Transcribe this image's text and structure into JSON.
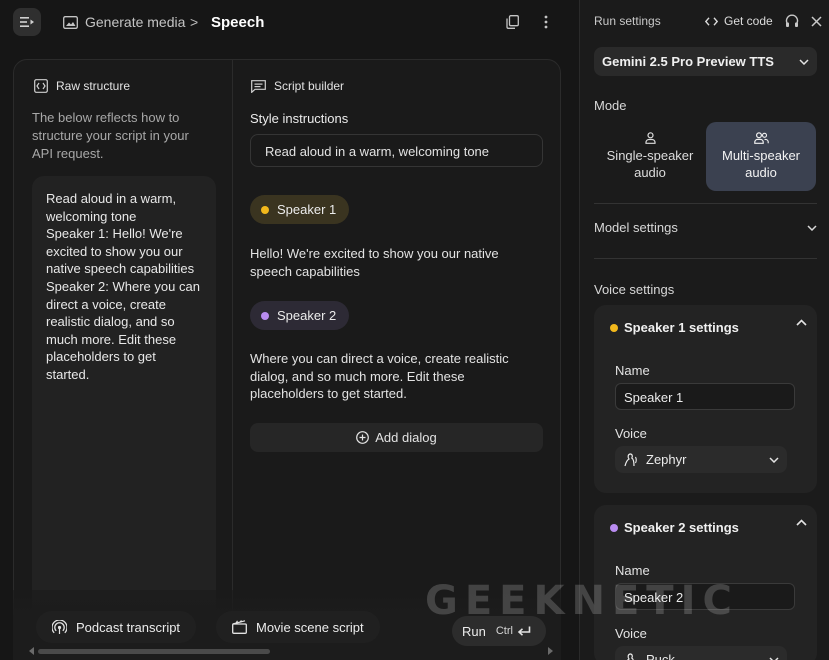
{
  "topbar": {
    "breadcrumb_parent": "Generate media",
    "breadcrumb_separator": ">",
    "breadcrumb_current": "Speech"
  },
  "raw_structure": {
    "heading": "Raw structure",
    "description": "The below reflects how to structure your script in your API request.",
    "content": "Read aloud in a warm, welcoming tone\nSpeaker 1: Hello! We're excited to show you our native speech capabilities\nSpeaker 2: Where you can direct a voice, create realistic dialog, and so much more. Edit these placeholders to get started."
  },
  "script_builder": {
    "heading": "Script builder",
    "style_label": "Style instructions",
    "style_value": "Read aloud in a warm, welcoming tone",
    "speaker1_name": "Speaker 1",
    "speaker1_text": "Hello! We're excited to show you our native speech capabilities",
    "speaker2_name": "Speaker 2",
    "speaker2_text": "Where you can direct a voice, create realistic dialog, and so much more. Edit these placeholders to get started.",
    "add_dialog": "Add dialog"
  },
  "bottom": {
    "podcast": "Podcast transcript",
    "movie": "Movie scene script",
    "run": "Run",
    "run_shortcut": "Ctrl"
  },
  "run_settings": {
    "title": "Run settings",
    "get_code": "Get code",
    "model": "Gemini 2.5 Pro Preview TTS",
    "mode_label": "Mode",
    "mode_single": "Single-speaker audio",
    "mode_multi": "Multi-speaker audio",
    "model_settings": "Model settings",
    "voice_settings": "Voice settings",
    "speaker1_settings": "Speaker 1 settings",
    "speaker2_settings": "Speaker 2 settings",
    "name_label": "Name",
    "voice_label": "Voice",
    "speaker1_name_value": "Speaker 1",
    "speaker1_voice": "Zephyr",
    "speaker2_name_value": "Speaker 2",
    "speaker2_voice": "Puck"
  },
  "watermark": "GEEKNETIC",
  "colors": {
    "speaker1_dot": "#f2b81c",
    "speaker2_dot": "#b98cf0",
    "mode_selected_bg": "#3b4150"
  },
  "icons": [
    "menu-collapse-icon",
    "image-icon",
    "copy-icon",
    "more-vert-icon",
    "raw-structure-icon",
    "script-builder-icon",
    "add-circle-icon",
    "podcast-icon",
    "movie-icon",
    "enter-icon",
    "code-icon",
    "compare-icon",
    "close-icon",
    "chevron-down-icon",
    "chevron-up-icon",
    "person-icon",
    "people-icon",
    "voice-icon"
  ]
}
